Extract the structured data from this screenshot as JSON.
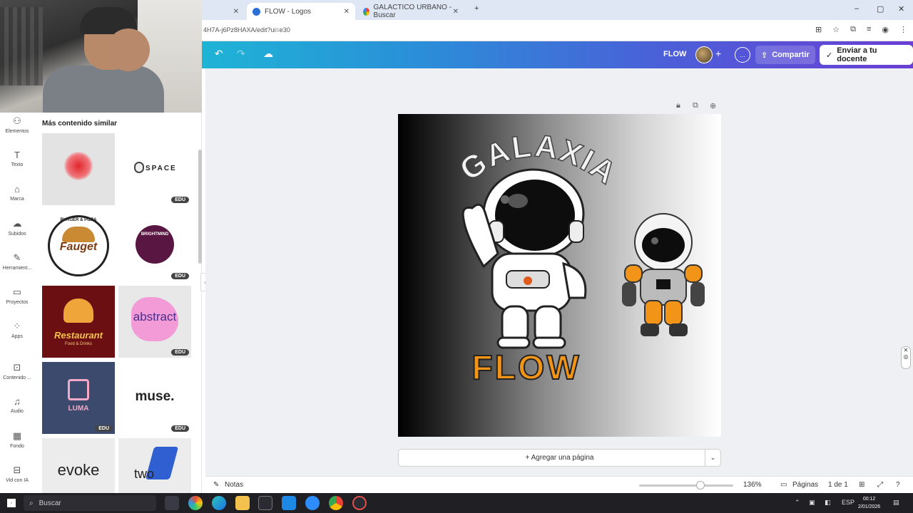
{
  "browser": {
    "tabs": [
      {
        "label": ""
      },
      {
        "label": "FLOW - Logos"
      },
      {
        "label": "GALACTICO URBANO - Buscar"
      }
    ],
    "url": "4H7A-j6Pz8HAXA/edit?ui=e30"
  },
  "toolbar": {
    "design_name": "FLOW",
    "share_label": "Compartir",
    "send_label": "Enviar a tu docente"
  },
  "rail": {
    "items": [
      {
        "label": "Elementos",
        "icon": "elements-icon"
      },
      {
        "label": "Texto",
        "icon": "text-icon"
      },
      {
        "label": "Marca",
        "icon": "brand-icon"
      },
      {
        "label": "Subidos",
        "icon": "upload-icon"
      },
      {
        "label": "Herramient...",
        "icon": "tools-icon"
      },
      {
        "label": "Proyectos",
        "icon": "folder-icon"
      },
      {
        "label": "Apps",
        "icon": "apps-icon"
      },
      {
        "label": "Contenido ...",
        "icon": "content-icon"
      },
      {
        "label": "Audio",
        "icon": "audio-icon"
      },
      {
        "label": "Fondo",
        "icon": "background-icon"
      },
      {
        "label": "Vid con IA",
        "icon": "ai-video-icon"
      }
    ]
  },
  "panel": {
    "title": "Más contenido similar",
    "badge": "EDU",
    "thumbs": {
      "space": "SPACE",
      "fauget": "Fauget",
      "fauget_top": "BURGER & PIZZA",
      "brightmind": "BRIGHTMIND",
      "restaurant": "Restaurant",
      "restaurant_sub": "Food & Drinks",
      "abstract": "abstract",
      "luma": "LUMA",
      "muse": "muse.",
      "evoke": "evoke",
      "two": "two"
    }
  },
  "design": {
    "arc_text": "GALAXIA",
    "main_text": "FLOW"
  },
  "canvas": {
    "add_page": "+ Agregar una página"
  },
  "bottom": {
    "notes": "Notas",
    "zoom": "136%",
    "pages_label": "Páginas",
    "page_count": "1 de 1"
  },
  "taskbar": {
    "search": "Buscar",
    "lang": "ESP",
    "time": "00:12",
    "date": "2/01/2026"
  }
}
